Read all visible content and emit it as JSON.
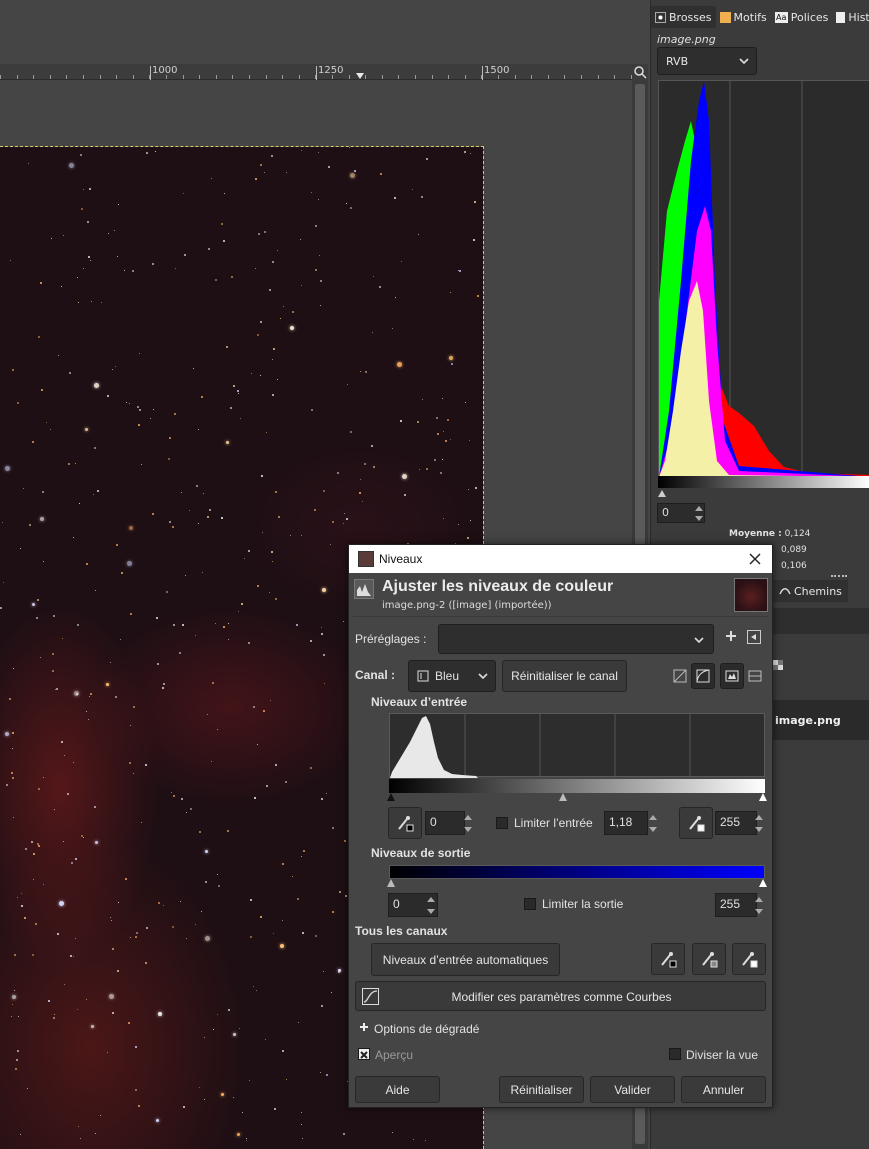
{
  "ruler": {
    "labels": [
      "1000",
      "1250",
      "1500"
    ]
  },
  "dock": {
    "tabs": [
      {
        "label": "Brosses",
        "icon": "brush-icon"
      },
      {
        "label": "Motifs",
        "icon": "pattern-icon"
      },
      {
        "label": "Polices",
        "icon": "font-icon",
        "icon_text": "Aa"
      },
      {
        "label": "Histo",
        "icon": "history-icon"
      }
    ],
    "image_name": "image.png",
    "channel": "RVB",
    "histogram_spin": "0",
    "stats": [
      {
        "key": "Moyenne :",
        "value": "0,124"
      },
      {
        "key": "",
        "value": "0,089"
      },
      {
        "key": "",
        "value": "0,106"
      }
    ],
    "paths_tab": "Chemins",
    "layer_name": "image.png"
  },
  "dialog": {
    "title": "Niveaux",
    "header_title": "Ajuster les niveaux de couleur",
    "header_subtitle": "image.png-2 ([image] (importée))",
    "presets_label": "Préréglages :",
    "presets_value": "",
    "channel_label": "Canal :",
    "channel_value": "Bleu",
    "reset_channel": "Réinitialiser le canal",
    "input_levels_heading": "Niveaux d’entrée",
    "input_low": "0",
    "clamp_input_label": "Limiter l’entrée",
    "input_gamma": "1,18",
    "input_high": "255",
    "output_levels_heading": "Niveaux de sortie",
    "output_low": "0",
    "clamp_output_label": "Limiter la sortie",
    "output_high": "255",
    "all_channels_heading": "Tous les canaux",
    "auto_button": "Niveaux d’entrée automatiques",
    "curves_button": "Modifier ces paramètres comme Courbes",
    "blending_options": "Options de dégradé",
    "preview_label": "Aperçu",
    "split_view_label": "Diviser la vue",
    "help": "Aide",
    "reset": "Réinitialiser",
    "ok": "Valider",
    "cancel": "Annuler"
  },
  "colors": {
    "accent_blue": "#0000ff",
    "histogram_red": "#ff0000",
    "histogram_green": "#00ff00",
    "histogram_blue": "#0000ff",
    "histogram_magenta": "#ff00ff",
    "histogram_yellow": "#ffff99"
  }
}
